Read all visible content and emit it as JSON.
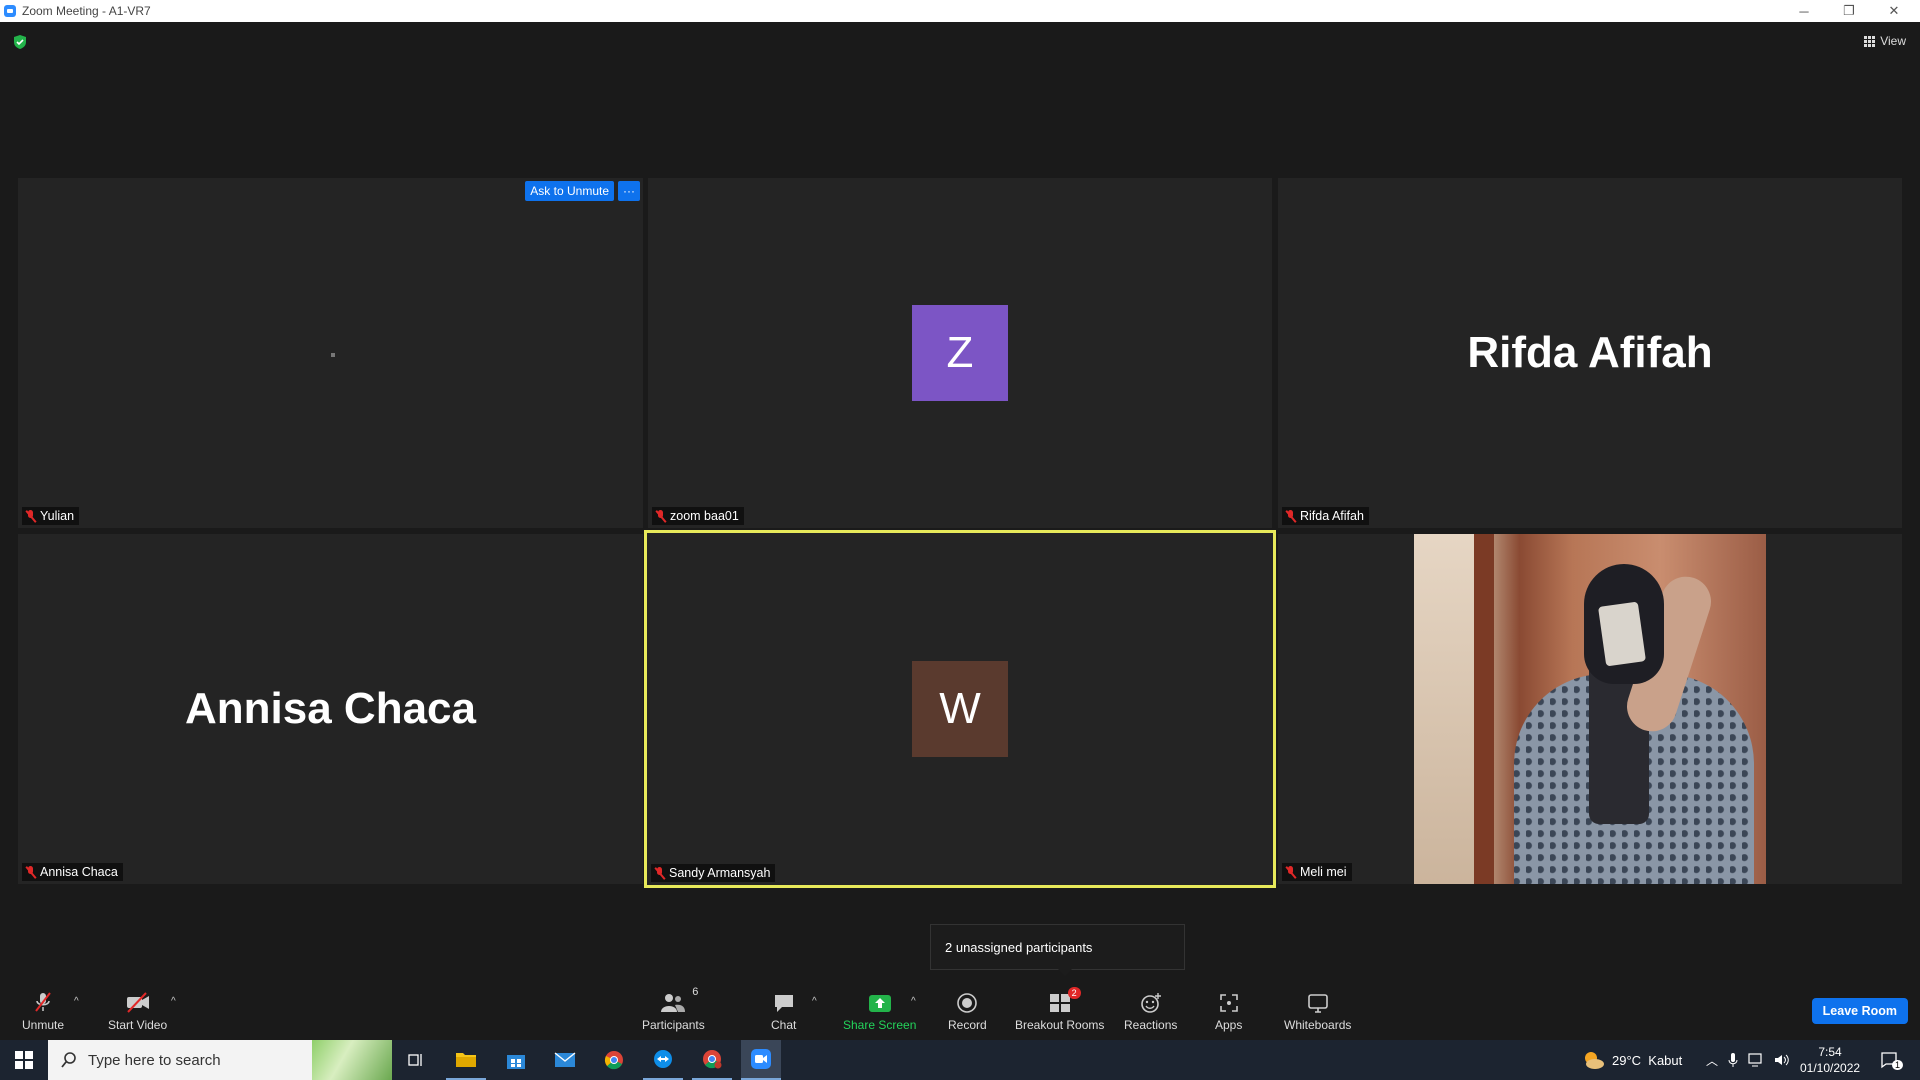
{
  "window": {
    "title": "Zoom Meeting - A1-VR7",
    "controls": [
      "─",
      "❐",
      "✕"
    ]
  },
  "header": {
    "view_label": "View"
  },
  "tiles": [
    {
      "name": "Yulian",
      "ask_unmute": "Ask to Unmute",
      "more": "···"
    },
    {
      "name": "zoom baa01",
      "avatar_letter": "Z",
      "avatar_color": "#7c55c5"
    },
    {
      "name": "Rifda Afifah",
      "display_name": "Rifda Afifah"
    },
    {
      "name": "Annisa Chaca",
      "display_name": "Annisa Chaca"
    },
    {
      "name": "Sandy Armansyah",
      "avatar_letter": "W",
      "avatar_color": "#5a3a2e",
      "active_speaker_color": "#e7e95a"
    },
    {
      "name": "Meli mei"
    }
  ],
  "tooltip": {
    "text": "2 unassigned participants"
  },
  "controls": {
    "unmute": "Unmute",
    "start_video": "Start Video",
    "participants": "Participants",
    "participants_count": "6",
    "chat": "Chat",
    "share_screen": "Share Screen",
    "record": "Record",
    "breakout_rooms": "Breakout Rooms",
    "breakout_badge": "2",
    "reactions": "Reactions",
    "apps": "Apps",
    "whiteboards": "Whiteboards",
    "leave": "Leave Room"
  },
  "taskbar": {
    "search_placeholder": "Type here to search",
    "weather": "29°C  Kabut",
    "time": "7:54",
    "date": "01/10/2022",
    "notifications": "1"
  }
}
